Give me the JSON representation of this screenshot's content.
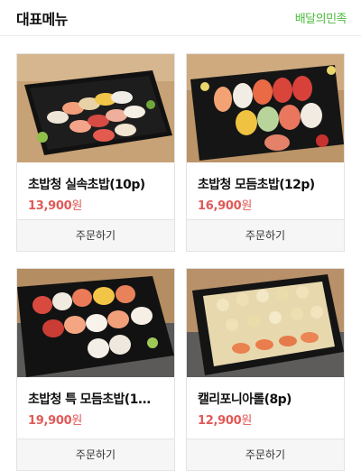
{
  "header": {
    "title": "대표메뉴",
    "brand_link": "배달의민족"
  },
  "menu": [
    {
      "name": "초밥청 실속초밥(10p)",
      "price": "13,900",
      "currency": "원",
      "order_label": "주문하기",
      "image": "sushi-platter-photo"
    },
    {
      "name": "초밥청 모듬초밥(12p)",
      "price": "16,900",
      "currency": "원",
      "order_label": "주문하기",
      "image": "sushi-platter-photo"
    },
    {
      "name": "초밥청 특 모듬초밥(1...",
      "price": "19,900",
      "currency": "원",
      "order_label": "주문하기",
      "image": "sushi-platter-photo"
    },
    {
      "name": "캘리포니아롤(8p)",
      "price": "12,900",
      "currency": "원",
      "order_label": "주문하기",
      "image": "california-roll-photo"
    }
  ],
  "colors": {
    "brand": "#4dbb3f",
    "price": "#e05a57"
  }
}
